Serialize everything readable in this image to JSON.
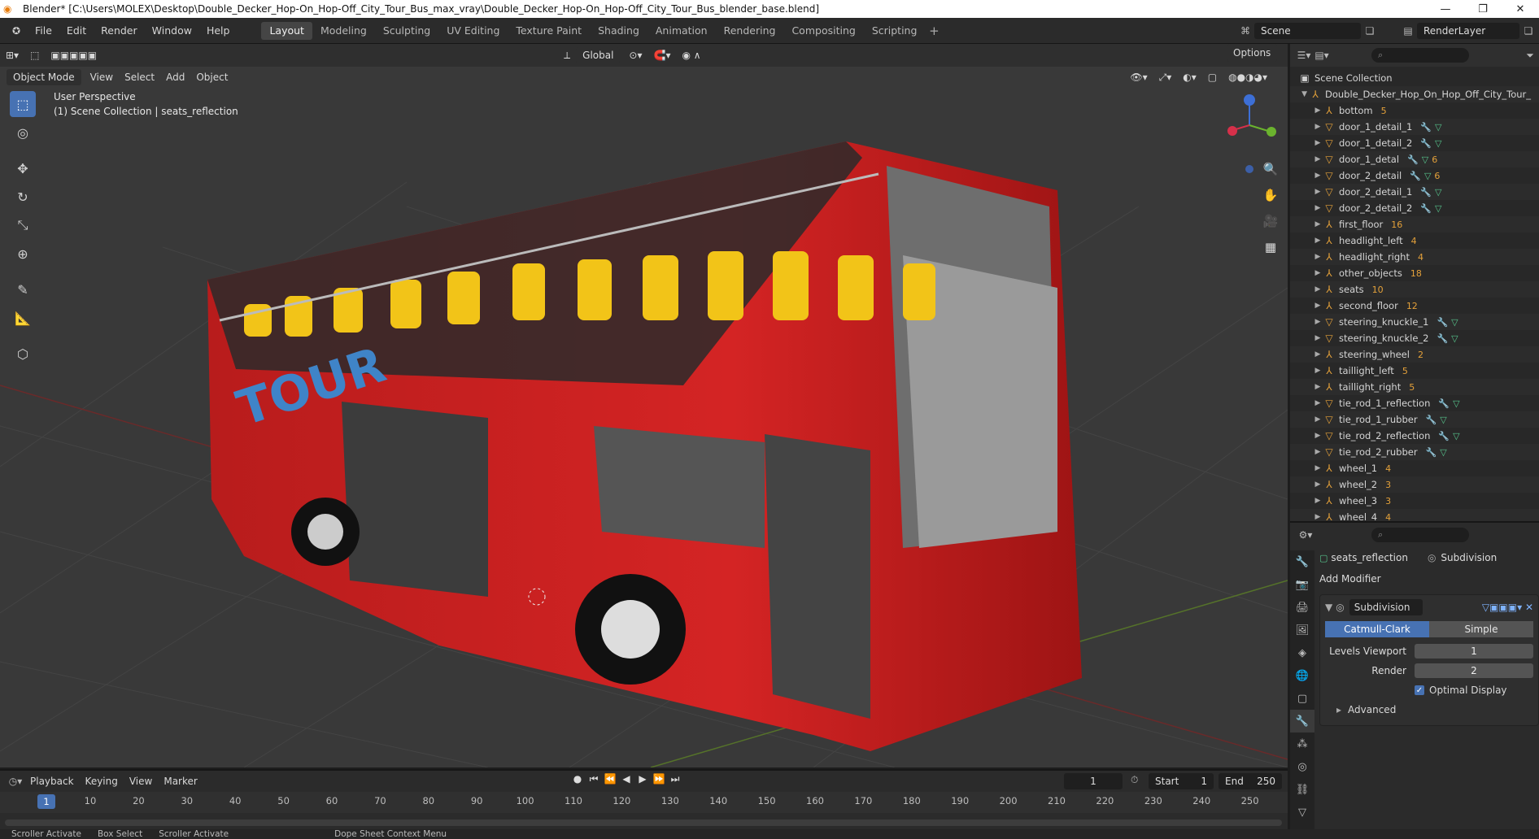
{
  "window": {
    "title": "Blender* [C:\\Users\\MOLEX\\Desktop\\Double_Decker_Hop-On_Hop-Off_City_Tour_Bus_max_vray\\Double_Decker_Hop-On_Hop-Off_City_Tour_Bus_blender_base.blend]"
  },
  "menu": [
    "File",
    "Edit",
    "Render",
    "Window",
    "Help"
  ],
  "workspaces": [
    {
      "label": "Layout",
      "active": true
    },
    {
      "label": "Modeling"
    },
    {
      "label": "Sculpting"
    },
    {
      "label": "UV Editing"
    },
    {
      "label": "Texture Paint"
    },
    {
      "label": "Shading"
    },
    {
      "label": "Animation"
    },
    {
      "label": "Rendering"
    },
    {
      "label": "Compositing"
    },
    {
      "label": "Scripting"
    }
  ],
  "scene": {
    "name": "Scene",
    "render_layer": "RenderLayer"
  },
  "viewport": {
    "mode": "Object Mode",
    "menus": [
      "View",
      "Select",
      "Add",
      "Object"
    ],
    "transform_orientation": "Global",
    "options_label": "Options",
    "perspective": "User Perspective",
    "context": "(1) Scene Collection | seats_reflection"
  },
  "outliner": {
    "root": "Scene Collection",
    "collection": "Double_Decker_Hop_On_Hop_Off_City_Tour_",
    "items": [
      {
        "name": "bottom",
        "badge": "5"
      },
      {
        "name": "door_1_detail_1",
        "mod": true,
        "mesh": true
      },
      {
        "name": "door_1_detail_2",
        "mod": true,
        "mesh": true
      },
      {
        "name": "door_1_detal",
        "mod": true,
        "mesh": true,
        "badge": "6"
      },
      {
        "name": "door_2_detail",
        "mod": true,
        "mesh": true,
        "badge": "6"
      },
      {
        "name": "door_2_detail_1",
        "mod": true,
        "mesh": true
      },
      {
        "name": "door_2_detail_2",
        "mod": true,
        "mesh": true
      },
      {
        "name": "first_floor",
        "badge": "16"
      },
      {
        "name": "headlight_left",
        "badge": "4"
      },
      {
        "name": "headlight_right",
        "badge": "4"
      },
      {
        "name": "other_objects",
        "badge": "18"
      },
      {
        "name": "seats",
        "badge": "10"
      },
      {
        "name": "second_floor",
        "badge": "12"
      },
      {
        "name": "steering_knuckle_1",
        "mod": true,
        "mesh": true
      },
      {
        "name": "steering_knuckle_2",
        "mod": true,
        "mesh": true
      },
      {
        "name": "steering_wheel",
        "badge": "2"
      },
      {
        "name": "taillight_left",
        "badge": "5"
      },
      {
        "name": "taillight_right",
        "badge": "5"
      },
      {
        "name": "tie_rod_1_reflection",
        "mod": true,
        "mesh": true
      },
      {
        "name": "tie_rod_1_rubber",
        "mod": true,
        "mesh": true
      },
      {
        "name": "tie_rod_2_reflection",
        "mod": true,
        "mesh": true
      },
      {
        "name": "tie_rod_2_rubber",
        "mod": true,
        "mesh": true
      },
      {
        "name": "wheel_1",
        "badge": "4"
      },
      {
        "name": "wheel_2",
        "badge": "3"
      },
      {
        "name": "wheel_3",
        "badge": "3"
      },
      {
        "name": "wheel_4",
        "badge": "4"
      }
    ]
  },
  "properties": {
    "object": "seats_reflection",
    "modifier_label": "Subdivision",
    "add_modifier": "Add Modifier",
    "modifier": {
      "name": "Subdivision",
      "types": [
        "Catmull-Clark",
        "Simple"
      ],
      "levels_viewport_label": "Levels Viewport",
      "levels_viewport": "1",
      "render_label": "Render",
      "render": "2",
      "optimal_display": "Optimal Display",
      "advanced": "Advanced"
    }
  },
  "timeline": {
    "menus": [
      "Playback",
      "Keying",
      "View",
      "Marker"
    ],
    "current_frame": "1",
    "start_label": "Start",
    "start": "1",
    "end_label": "End",
    "end": "250",
    "ticks": [
      "10",
      "20",
      "30",
      "40",
      "50",
      "60",
      "70",
      "80",
      "90",
      "100",
      "110",
      "120",
      "130",
      "140",
      "150",
      "160",
      "170",
      "180",
      "190",
      "200",
      "210",
      "220",
      "230",
      "240",
      "250"
    ]
  },
  "statusbar": [
    "Scroller Activate",
    "Box Select",
    "Scroller Activate",
    "Dope Sheet Context Menu"
  ]
}
